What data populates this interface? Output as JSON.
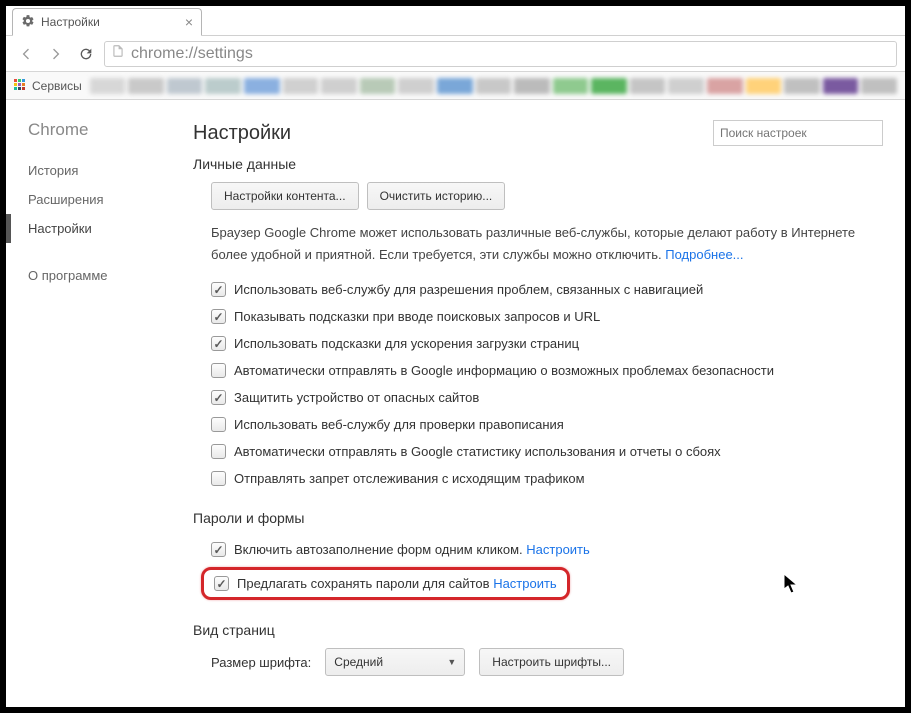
{
  "tab": {
    "title": "Настройки"
  },
  "url": "chrome://settings",
  "bookbar": {
    "apps_label": "Сервисы"
  },
  "sidebar": {
    "brand": "Chrome",
    "items": [
      {
        "label": "История"
      },
      {
        "label": "Расширения"
      },
      {
        "label": "Настройки"
      },
      {
        "label": "О программе"
      }
    ]
  },
  "main": {
    "title": "Настройки",
    "search_placeholder": "Поиск настроек"
  },
  "privacy": {
    "section_title": "Личные данные",
    "btn_content": "Настройки контента...",
    "btn_clear": "Очистить историю...",
    "desc_a": "Браузер Google Chrome может использовать различные веб-службы, которые делают работу в Интернете более удобной и приятной. Если требуется, эти службы можно отключить. ",
    "desc_link": "Подробнее...",
    "checks": [
      {
        "checked": true,
        "label": "Использовать веб-службу для разрешения проблем, связанных с навигацией"
      },
      {
        "checked": true,
        "label": "Показывать подсказки при вводе поисковых запросов и URL"
      },
      {
        "checked": true,
        "label": "Использовать подсказки для ускорения загрузки страниц"
      },
      {
        "checked": false,
        "label": "Автоматически отправлять в Google информацию о возможных проблемах безопасности"
      },
      {
        "checked": true,
        "label": "Защитить устройство от опасных сайтов"
      },
      {
        "checked": false,
        "label": "Использовать веб-службу для проверки правописания"
      },
      {
        "checked": false,
        "label": "Автоматически отправлять в Google статистику использования и отчеты о сбоях"
      },
      {
        "checked": false,
        "label": "Отправлять запрет отслеживания с исходящим трафиком"
      }
    ]
  },
  "passwords": {
    "section_title": "Пароли и формы",
    "autofill_label": "Включить автозаполнение форм одним кликом. ",
    "autofill_link": "Настроить",
    "save_pw_label": "Предлагать сохранять пароли для сайтов ",
    "save_pw_link": "Настроить"
  },
  "appearance": {
    "section_title": "Вид страниц",
    "font_size_label": "Размер шрифта:",
    "font_size_value": "Средний",
    "btn_fonts": "Настроить шрифты..."
  },
  "blur_colors": [
    "#d7d7d7",
    "#c9c9c9",
    "#bfc8d0",
    "#bcc",
    "#8bb0e0",
    "#d0d0d0",
    "#cfcfcf",
    "#b8cab7",
    "#cfcfcf",
    "#7aa7d8",
    "#c8c8c8",
    "#bbb",
    "#8fca8f",
    "#5bb561",
    "#c5c5c5",
    "#cfcfcf",
    "#d9a3a3",
    "#ffd27a",
    "#c0c0c0",
    "#7a5aa0",
    "#c0c0c0"
  ]
}
